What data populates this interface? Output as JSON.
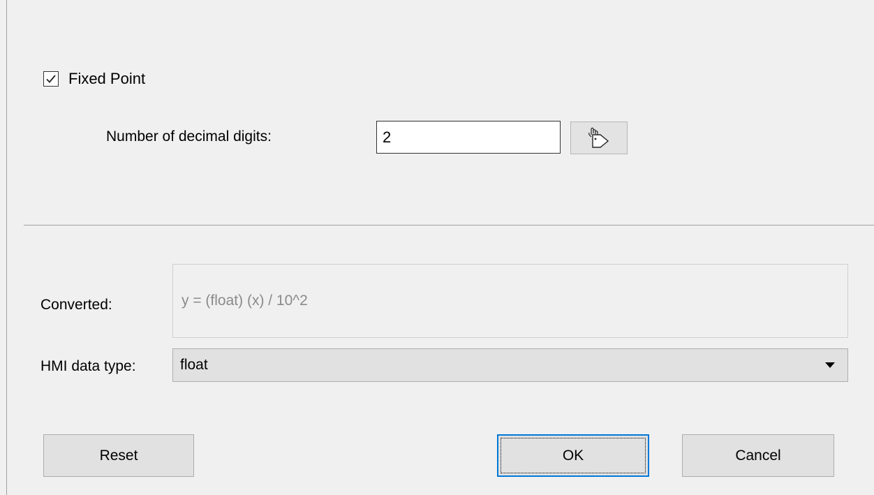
{
  "fixed_point": {
    "label": "Fixed Point",
    "checked": true
  },
  "decimal_digits": {
    "label": "Number of decimal digits:",
    "value": "2",
    "tag_button_icon": "tag-pointer-icon"
  },
  "converted": {
    "label": "Converted:",
    "value": "y = (float) (x) / 10^2"
  },
  "hmi_data_type": {
    "label": "HMI data type:",
    "selected": "float",
    "arrow_icon": "dropdown-arrow-icon"
  },
  "buttons": {
    "reset": "Reset",
    "ok": "OK",
    "cancel": "Cancel"
  },
  "colors": {
    "background": "#f0f0f0",
    "focus_border": "#0078d7",
    "disabled_text": "#8a8a8a"
  }
}
